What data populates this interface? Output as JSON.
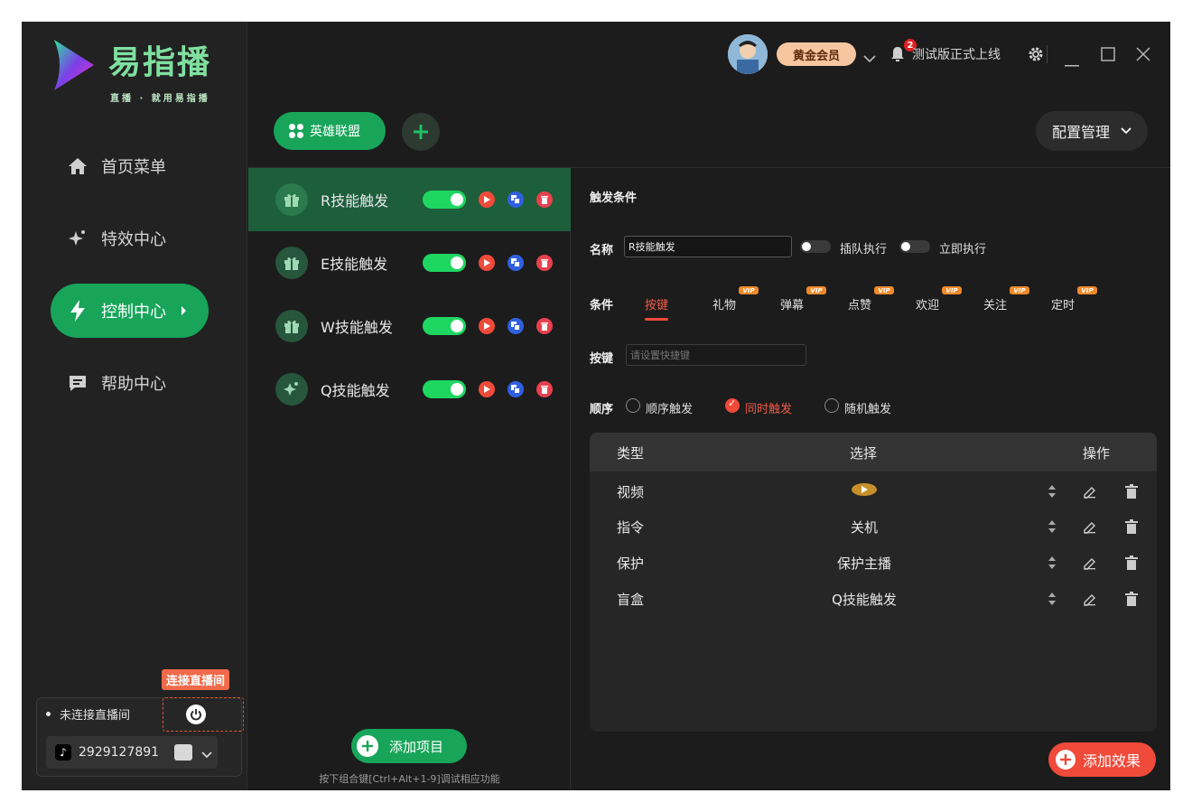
{
  "app": {
    "title": "易指播",
    "subtitle": "直播 · 就用易指播"
  },
  "sidebar": {
    "items": [
      {
        "label": "首页菜单",
        "icon": "home-icon"
      },
      {
        "label": "特效中心",
        "icon": "sparkle-icon"
      },
      {
        "label": "控制中心",
        "icon": "lightning-icon",
        "active": true
      },
      {
        "label": "帮助中心",
        "icon": "chat-icon"
      }
    ],
    "connect_badge": "连接直播间",
    "status": "未连接直播间",
    "account_id": "2929127891"
  },
  "header": {
    "vip_label": "黄金会员",
    "notification_count": "2",
    "notice_text": "测试版正式上线"
  },
  "tabs": {
    "game_tab": "英雄联盟",
    "config_button": "配置管理"
  },
  "skills": [
    {
      "name": "R技能触发",
      "active": true
    },
    {
      "name": "E技能触发"
    },
    {
      "name": "W技能触发"
    },
    {
      "name": "Q技能触发"
    }
  ],
  "list_footer": {
    "add_button": "添加项目",
    "hint": "按下组合键[Ctrl+Alt+1-9]调试相应功能"
  },
  "panel": {
    "section_title": "触发条件",
    "name_label": "名称",
    "name_value": "R技能触发",
    "queue_label": "插队执行",
    "immediate_label": "立即执行",
    "condition_label": "条件",
    "condition_tabs": [
      "按键",
      "礼物",
      "弹幕",
      "点赞",
      "欢迎",
      "关注",
      "定时"
    ],
    "vip_tag": "VIP",
    "key_label": "按键",
    "key_placeholder": "请设置快捷键",
    "order_label": "顺序",
    "order_options": [
      "顺序触发",
      "同时触发",
      "随机触发"
    ],
    "order_selected": "同时触发"
  },
  "table": {
    "headers": [
      "类型",
      "选择",
      "操作"
    ],
    "rows": [
      {
        "type": "视频",
        "choice": ""
      },
      {
        "type": "指令",
        "choice": "关机"
      },
      {
        "type": "保护",
        "choice": "保护主播"
      },
      {
        "type": "盲盒",
        "choice": "Q技能触发"
      }
    ]
  },
  "add_effect": "添加效果",
  "colors": {
    "accent_green": "#18a55a",
    "accent_red": "#f04a3a",
    "vip_gold": "#f6c6a0"
  }
}
